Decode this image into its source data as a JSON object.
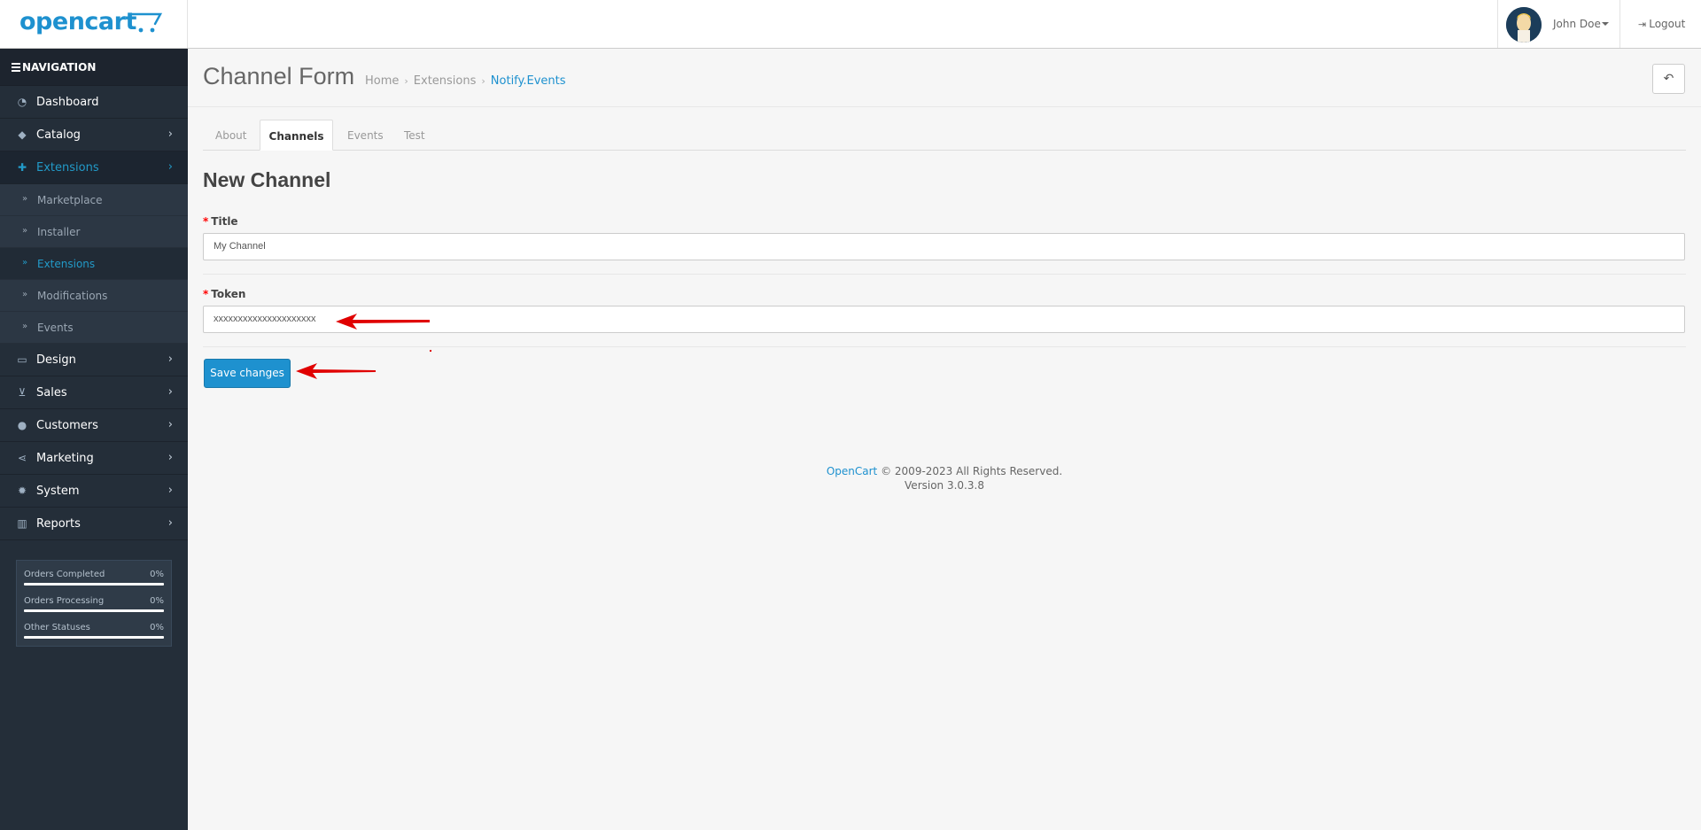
{
  "header": {
    "logo_text": "opencart",
    "user_name": "John Doe",
    "logout_label": "Logout"
  },
  "sidebar": {
    "heading": "NAVIGATION",
    "items": [
      {
        "label": "Dashboard",
        "icon": "dashboard-icon"
      },
      {
        "label": "Catalog",
        "icon": "tags-icon"
      },
      {
        "label": "Extensions",
        "icon": "puzzle-icon"
      },
      {
        "label": "Design",
        "icon": "monitor-icon"
      },
      {
        "label": "Sales",
        "icon": "cart-icon"
      },
      {
        "label": "Customers",
        "icon": "user-icon"
      },
      {
        "label": "Marketing",
        "icon": "share-icon"
      },
      {
        "label": "System",
        "icon": "gear-icon"
      },
      {
        "label": "Reports",
        "icon": "bar-chart-icon"
      }
    ],
    "extensions_sub": [
      {
        "label": "Marketplace"
      },
      {
        "label": "Installer"
      },
      {
        "label": "Extensions"
      },
      {
        "label": "Modifications"
      },
      {
        "label": "Events"
      }
    ],
    "stats": [
      {
        "label": "Orders Completed",
        "value": "0%",
        "progress": 0
      },
      {
        "label": "Orders Processing",
        "value": "0%",
        "progress": 0
      },
      {
        "label": "Other Statuses",
        "value": "0%",
        "progress": 0
      }
    ]
  },
  "page": {
    "title": "Channel Form",
    "breadcrumb": [
      "Home",
      "Extensions",
      "Notify.Events"
    ]
  },
  "tabs": [
    {
      "label": "About"
    },
    {
      "label": "Channels"
    },
    {
      "label": "Events"
    },
    {
      "label": "Test"
    }
  ],
  "form": {
    "heading": "New Channel",
    "required_mark": "*",
    "title_label": "Title",
    "title_value": "My Channel",
    "token_label": "Token",
    "token_value": "xxxxxxxxxxxxxxxxxxxxx",
    "save_label": "Save changes"
  },
  "footer": {
    "brand": "OpenCart",
    "copyright": "© 2009-2023 All Rights Reserved.",
    "version": "Version 3.0.3.8"
  },
  "colors": {
    "accent": "#1e91cf",
    "sidebar_bg": "#242e39",
    "annotation_arrow": "#e00000"
  }
}
